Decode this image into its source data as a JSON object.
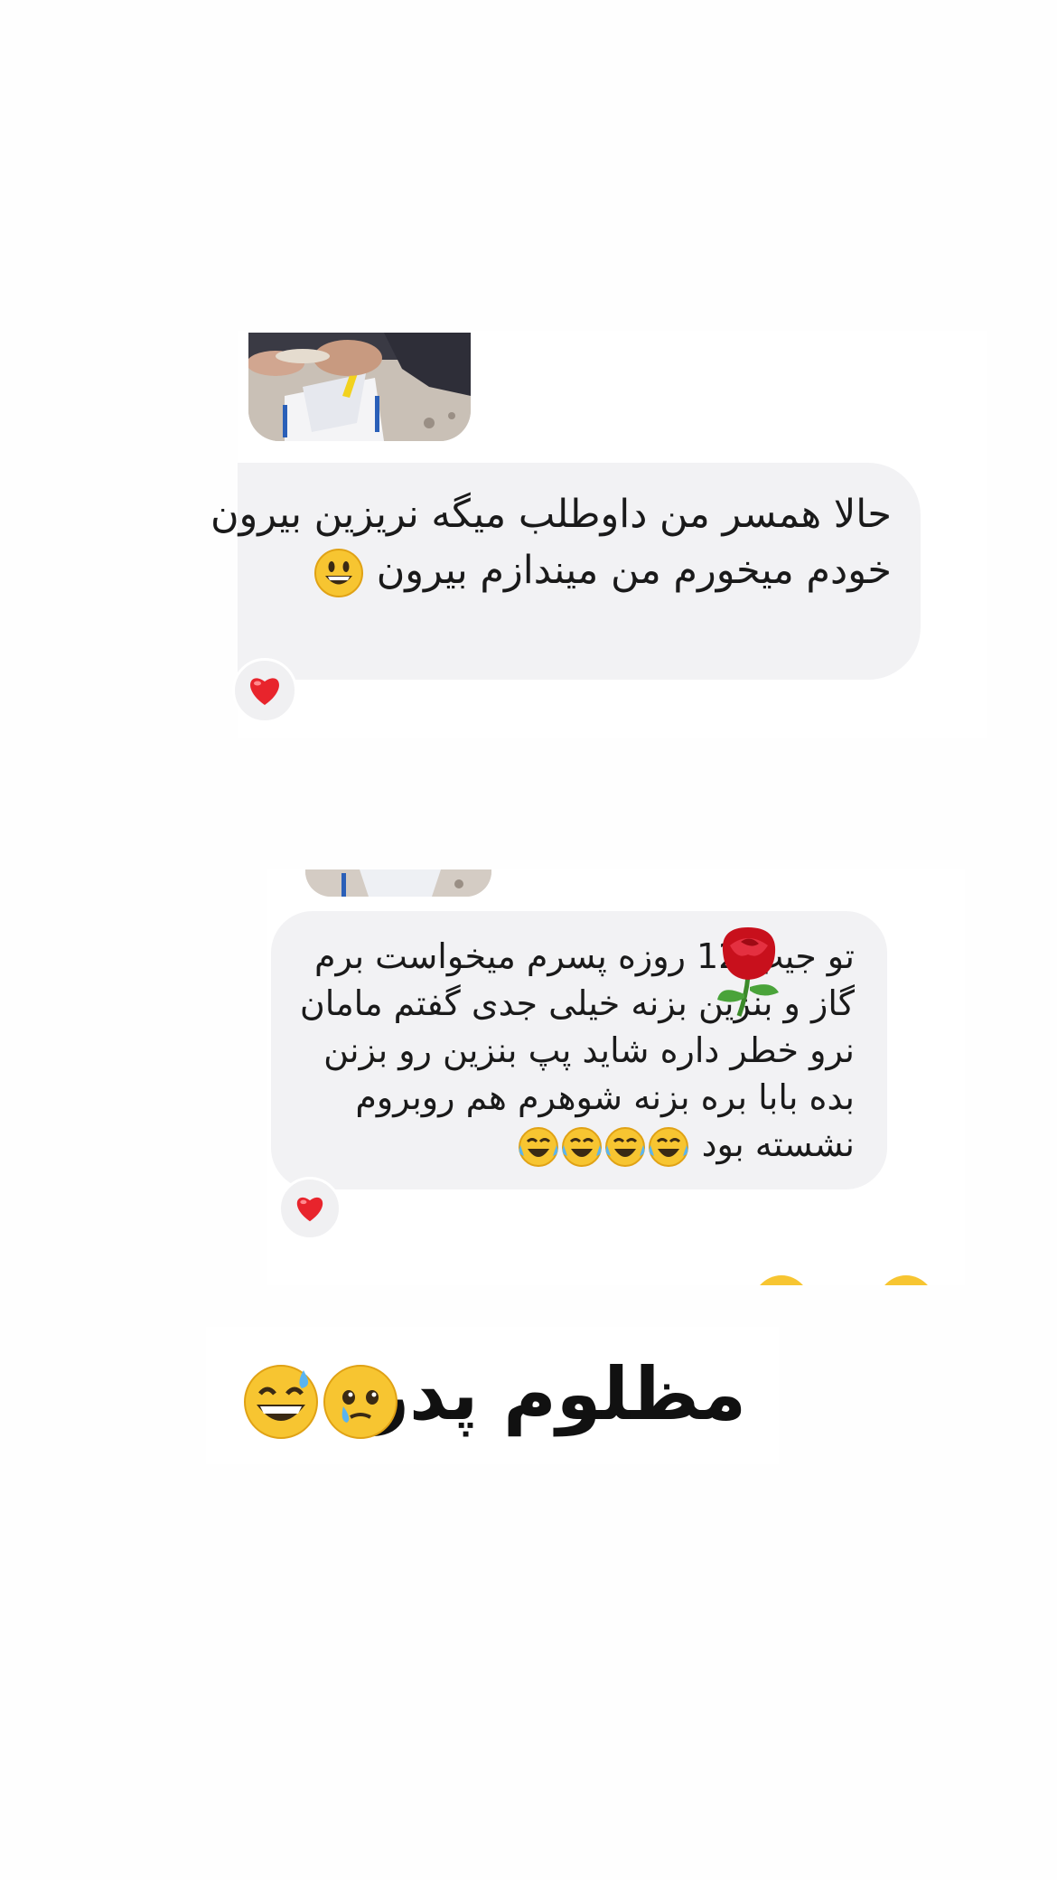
{
  "screenshot_1": {
    "message_text": "حالا همسر من داوطلب میگه نریزین بیرون خودم میخورم من میندازم بیرون",
    "trailing_emoji": "grinning-face-emoji",
    "reaction": "red-heart"
  },
  "screenshot_2": {
    "message_text": "تو جیب 12 روزه پسرم میخواست برم گاز و بنزین بزنه خیلی جدی گفتم مامان نرو خطر داره شاید  پپ بنزین رو بزنن بده بابا بره بزنه  شوهرم هم روبروم نشسته بود",
    "inline_emoji": "rose-emoji",
    "trailing_emojis": [
      "tears-of-joy-emoji",
      "tears-of-joy-emoji",
      "tears-of-joy-emoji",
      "tears-of-joy-emoji"
    ],
    "reaction": "red-heart"
  },
  "caption": {
    "text": "مظلوم پدر",
    "emojis": [
      "face-holding-back-tears-emoji",
      "grinning-sweat-emoji"
    ]
  },
  "colors": {
    "bubble": "#f2f2f4",
    "heart": "#e8242c",
    "background": "#fefefe"
  }
}
